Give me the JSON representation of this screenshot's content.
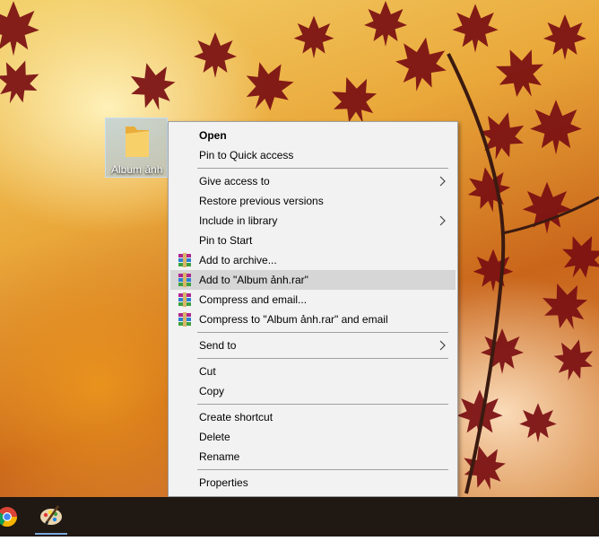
{
  "desktop": {
    "folder_label": "Album ảnh"
  },
  "context_menu": {
    "open": "Open",
    "pin_quick_access": "Pin to Quick access",
    "give_access_to": "Give access to",
    "restore_previous_versions": "Restore previous versions",
    "include_in_library": "Include in library",
    "pin_to_start": "Pin to Start",
    "add_to_archive": "Add to archive...",
    "add_to_rar": "Add to \"Album ảnh.rar\"",
    "compress_and_email": "Compress and email...",
    "compress_to_rar_and_email": "Compress to \"Album ảnh.rar\" and email",
    "send_to": "Send to",
    "cut": "Cut",
    "copy": "Copy",
    "create_shortcut": "Create shortcut",
    "delete": "Delete",
    "rename": "Rename",
    "properties": "Properties"
  },
  "colors": {
    "menu_background": "#f2f2f2",
    "menu_hover": "#d6d6d6",
    "taskbar": "#201812",
    "folder": "#f6c453"
  },
  "icons": {
    "rar": "winrar-icon",
    "folder": "folder-icon",
    "chrome": "chrome-icon",
    "paint": "paint-icon"
  }
}
